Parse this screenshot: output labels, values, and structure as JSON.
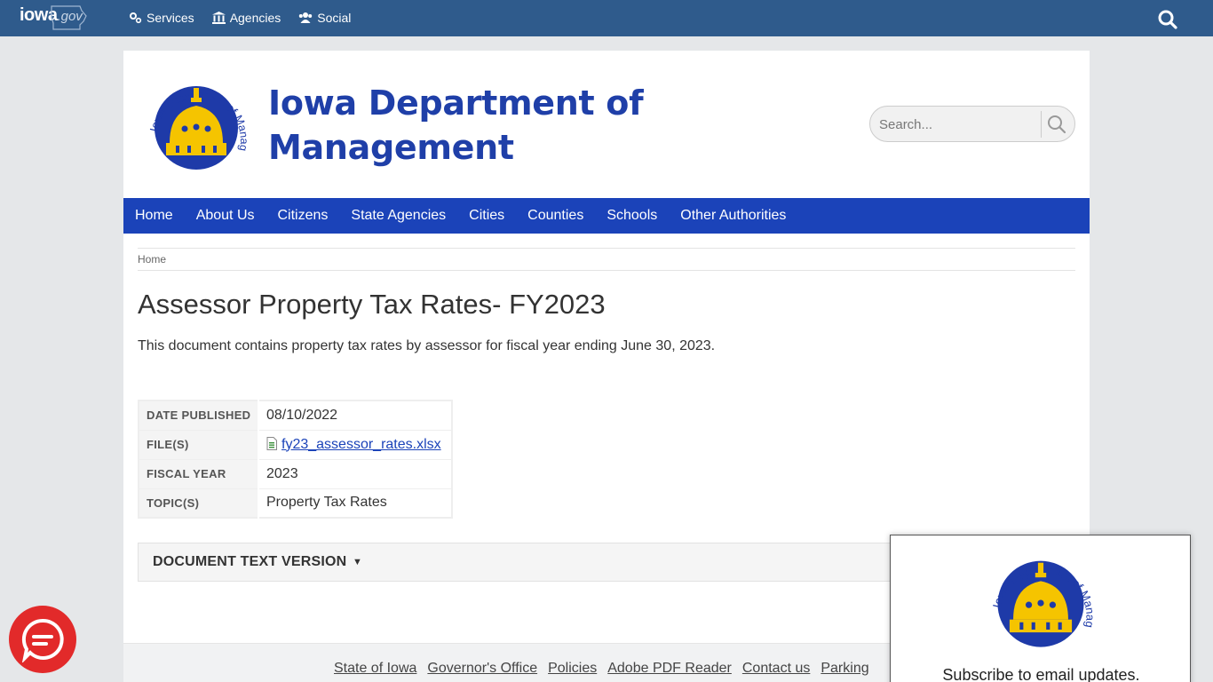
{
  "topbar": {
    "logo_main": "iowa",
    "logo_suffix": ".gov",
    "nav": [
      {
        "label": "Services",
        "icon": "gears-icon"
      },
      {
        "label": "Agencies",
        "icon": "building-icon"
      },
      {
        "label": "Social",
        "icon": "users-icon"
      }
    ]
  },
  "header": {
    "title_line1": "Iowa Department of",
    "title_line2": "Management",
    "seal_text": "Iowa Department of Management",
    "search_placeholder": "Search..."
  },
  "mainnav": [
    "Home",
    "About Us",
    "Citizens",
    "State Agencies",
    "Cities",
    "Counties",
    "Schools",
    "Other Authorities"
  ],
  "breadcrumb": "Home",
  "page": {
    "title": "Assessor Property Tax Rates- FY2023",
    "lead": "This document contains property tax rates by assessor for fiscal year ending June 30, 2023."
  },
  "meta": {
    "date_label": "DATE PUBLISHED",
    "date_value": "08/10/2022",
    "files_label": "FILE(S)",
    "file_name": "fy23_assessor_rates.xlsx",
    "fiscal_label": "FISCAL YEAR",
    "fiscal_value": "2023",
    "topics_label": "TOPIC(S)",
    "topics_value": "Property Tax Rates"
  },
  "doc_text": {
    "label": "DOCUMENT TEXT VERSION",
    "caret": "▼"
  },
  "footer": [
    "State of Iowa",
    "Governor's Office",
    "Policies",
    "Adobe PDF Reader",
    "Contact us",
    "Parking"
  ],
  "popup": {
    "subscribe": "Subscribe to email updates."
  },
  "colors": {
    "topbar": "#2f5b8c",
    "brand_blue": "#1b43b9",
    "title_blue": "#1f3fa8",
    "seal_gold": "#f5c400",
    "chat_red": "#e22a2a"
  }
}
